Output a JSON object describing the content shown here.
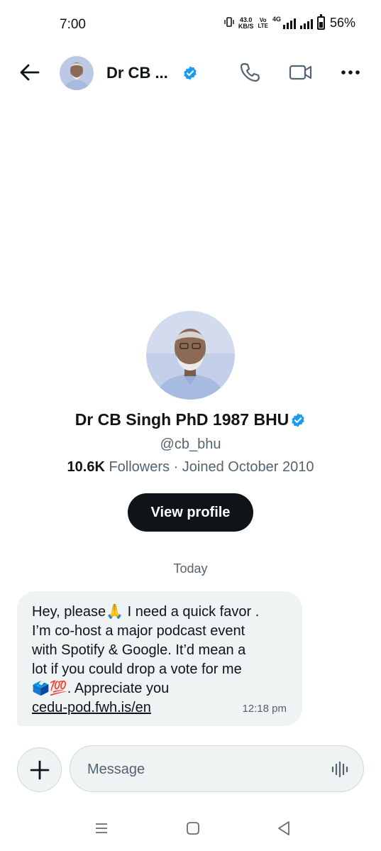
{
  "status_bar": {
    "time": "7:00",
    "net_speed_value": "43.0",
    "net_speed_unit": "KB/S",
    "volte_top": "Vo",
    "volte_bottom": "LTE",
    "network_type": "4G",
    "battery_percent": "56%",
    "battery_level": 0.56,
    "icons": [
      "vibrate-icon",
      "signal-icon",
      "battery-icon"
    ]
  },
  "header": {
    "contact_name": "Dr CB ...",
    "verified": true,
    "icons": [
      "back-arrow-icon",
      "phone-icon",
      "video-icon",
      "more-icon"
    ]
  },
  "profile": {
    "name": "Dr CB Singh PhD 1987 BHU",
    "handle": "@cb_bhu",
    "followers_count": "10.6K",
    "followers_rest": " Followers · Joined October 2010",
    "view_profile_label": "View profile"
  },
  "conversation": {
    "date_divider": "Today",
    "messages": [
      {
        "text": "Hey, please🙏 I need a quick favor .\nI’m co-host a major podcast event\nwith Spotify & Google. It’d mean a\nlot if you could drop a vote for me\n🗳️💯. Appreciate you",
        "link": "cedu-pod.fwh.is/en",
        "time": "12:18 pm"
      }
    ]
  },
  "composer": {
    "placeholder": "Message",
    "icons": [
      "plus-icon",
      "voice-icon"
    ]
  },
  "colors": {
    "accent_verified": "#1d9bf0",
    "text_primary": "#0f1419",
    "text_secondary": "#536471",
    "bubble_bg": "#eff3f4"
  }
}
